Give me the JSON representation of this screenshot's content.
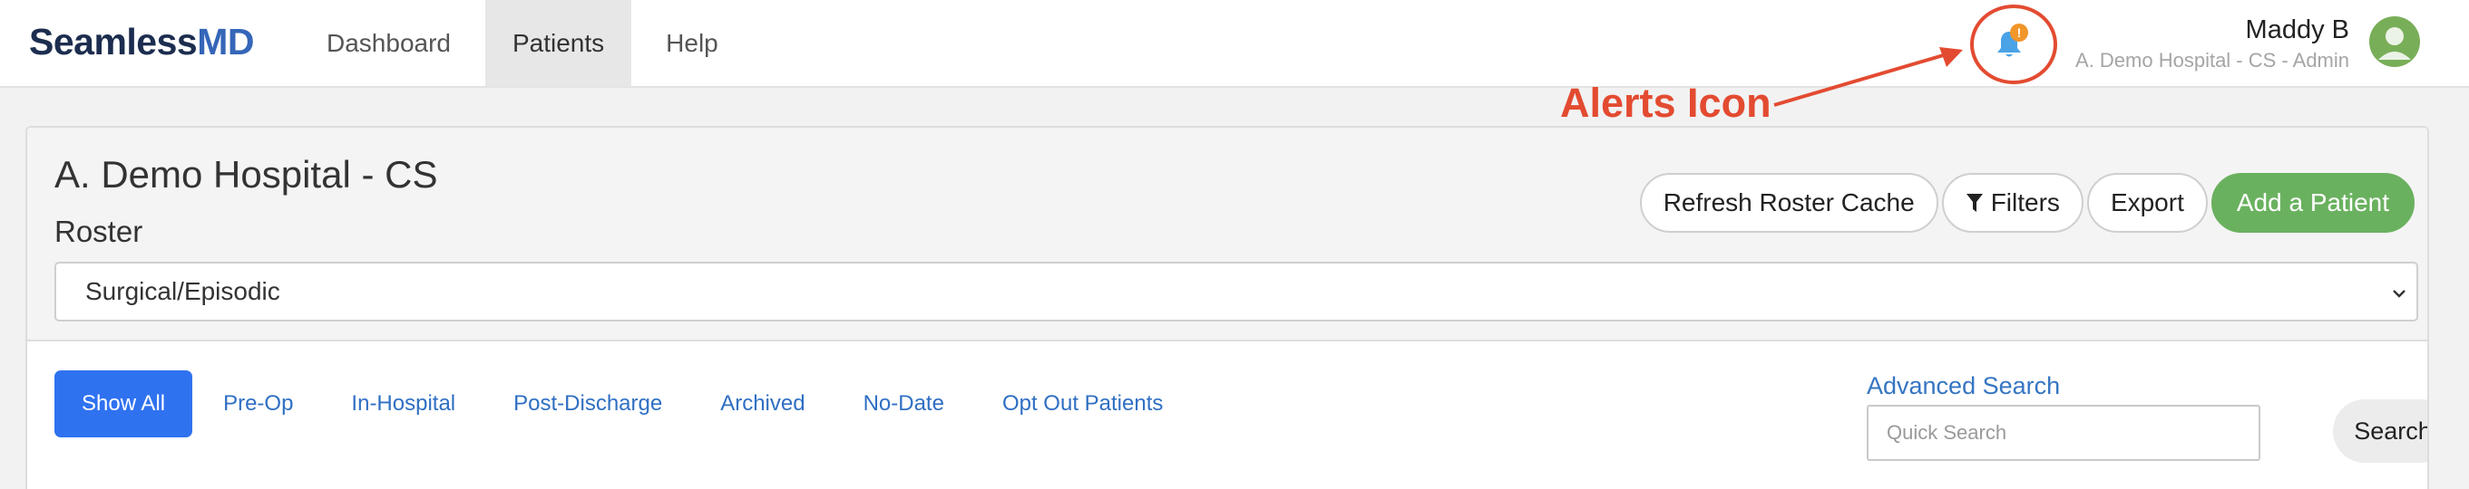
{
  "brand": {
    "logo_part1": "Seamless",
    "logo_part2": "MD"
  },
  "nav": {
    "items": [
      {
        "label": "Dashboard",
        "active": false
      },
      {
        "label": "Patients",
        "active": true
      },
      {
        "label": "Help",
        "active": false
      }
    ]
  },
  "alerts": {
    "badge": "!",
    "icon": "bell-icon",
    "annotation": "Alerts Icon"
  },
  "user": {
    "name": "Maddy B",
    "org": "A. Demo Hospital - CS - Admin"
  },
  "main": {
    "hospital": "A. Demo Hospital - CS",
    "roster_label": "Roster",
    "roster_value": "Surgical/Episodic",
    "actions": {
      "refresh": "Refresh Roster Cache",
      "filters": "Filters",
      "export": "Export",
      "add_patient": "Add a Patient"
    },
    "tabs": [
      "Show All",
      "Pre-Op",
      "In-Hospital",
      "Post-Discharge",
      "Archived",
      "No-Date",
      "Opt Out Patients"
    ],
    "active_tab": "Show All",
    "search": {
      "advanced": "Advanced Search",
      "placeholder": "Quick Search",
      "button": "Search"
    }
  },
  "colors": {
    "brand_dark": "#1c2d4f",
    "brand_blue": "#3566b8",
    "accent_green": "#6ab15f",
    "tab_active": "#2f72f0",
    "link_blue": "#2f6fc3",
    "annotation_red": "#e34b31",
    "badge_orange": "#f0962a"
  }
}
